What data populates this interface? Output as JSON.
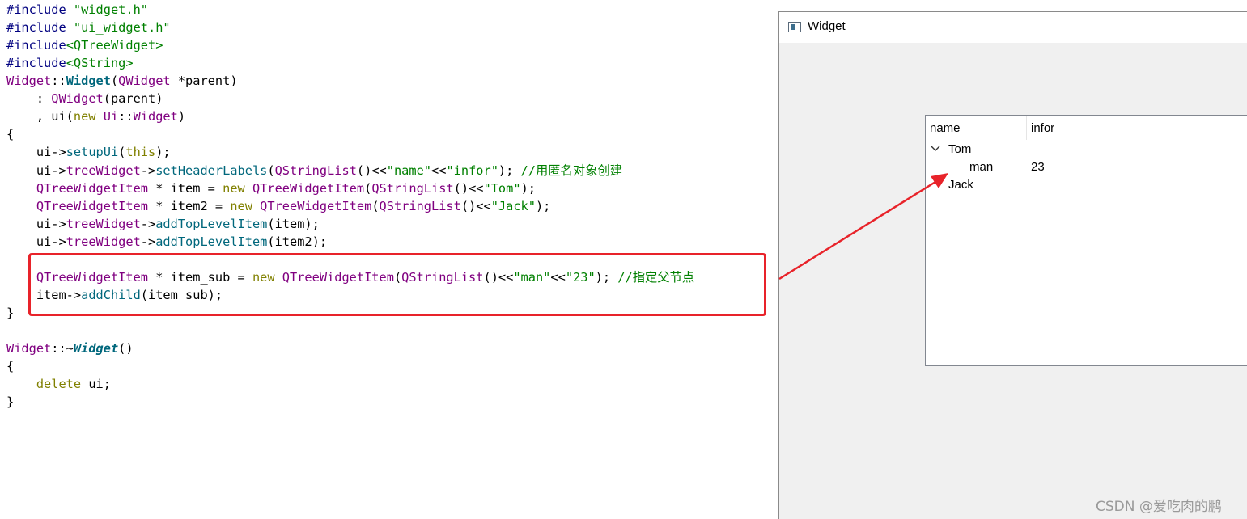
{
  "code": {
    "lines": [
      [
        [
          "#include ",
          "pre"
        ],
        [
          "\"widget.h\"",
          "str"
        ]
      ],
      [
        [
          "#include ",
          "pre"
        ],
        [
          "\"ui_widget.h\"",
          "str"
        ]
      ],
      [
        [
          "#include",
          "pre"
        ],
        [
          "<QTreeWidget>",
          "str"
        ]
      ],
      [
        [
          "#include",
          "pre"
        ],
        [
          "<QString>",
          "str"
        ]
      ],
      [
        [
          "Widget",
          "type"
        ],
        [
          "::",
          "plain"
        ],
        [
          "Widget",
          "funcbold"
        ],
        [
          "(",
          "plain"
        ],
        [
          "QWidget",
          "type"
        ],
        [
          " *parent)",
          "plain"
        ]
      ],
      [
        [
          "    : ",
          "plain"
        ],
        [
          "QWidget",
          "type"
        ],
        [
          "(parent)",
          "plain"
        ]
      ],
      [
        [
          "    , ui(",
          "plain"
        ],
        [
          "new",
          "kw"
        ],
        [
          " ",
          "plain"
        ],
        [
          "Ui",
          "type"
        ],
        [
          "::",
          "plain"
        ],
        [
          "Widget",
          "type"
        ],
        [
          ")",
          "plain"
        ]
      ],
      [
        [
          "{",
          "plain"
        ]
      ],
      [
        [
          "    ui->",
          "plain"
        ],
        [
          "setupUi",
          "func"
        ],
        [
          "(",
          "plain"
        ],
        [
          "this",
          "kw"
        ],
        [
          ");",
          "plain"
        ]
      ],
      [
        [
          "    ui->",
          "plain"
        ],
        [
          "treeWidget",
          "type"
        ],
        [
          "->",
          "plain"
        ],
        [
          "setHeaderLabels",
          "func"
        ],
        [
          "(",
          "plain"
        ],
        [
          "QStringList",
          "type"
        ],
        [
          "()<<",
          "plain"
        ],
        [
          "\"name\"",
          "str"
        ],
        [
          "<<",
          "plain"
        ],
        [
          "\"infor\"",
          "str"
        ],
        [
          "); ",
          "plain"
        ],
        [
          "//用匿名对象创建",
          "comment"
        ]
      ],
      [
        [
          "    ",
          "plain"
        ],
        [
          "QTreeWidgetItem",
          "type"
        ],
        [
          " * item = ",
          "plain"
        ],
        [
          "new",
          "kw"
        ],
        [
          " ",
          "plain"
        ],
        [
          "QTreeWidgetItem",
          "type"
        ],
        [
          "(",
          "plain"
        ],
        [
          "QStringList",
          "type"
        ],
        [
          "()<<",
          "plain"
        ],
        [
          "\"Tom\"",
          "str"
        ],
        [
          ");",
          "plain"
        ]
      ],
      [
        [
          "    ",
          "plain"
        ],
        [
          "QTreeWidgetItem",
          "type"
        ],
        [
          " * item2 = ",
          "plain"
        ],
        [
          "new",
          "kw"
        ],
        [
          " ",
          "plain"
        ],
        [
          "QTreeWidgetItem",
          "type"
        ],
        [
          "(",
          "plain"
        ],
        [
          "QStringList",
          "type"
        ],
        [
          "()<<",
          "plain"
        ],
        [
          "\"Jack\"",
          "str"
        ],
        [
          ");",
          "plain"
        ]
      ],
      [
        [
          "    ui->",
          "plain"
        ],
        [
          "treeWidget",
          "type"
        ],
        [
          "->",
          "plain"
        ],
        [
          "addTopLevelItem",
          "func"
        ],
        [
          "(item);",
          "plain"
        ]
      ],
      [
        [
          "    ui->",
          "plain"
        ],
        [
          "treeWidget",
          "type"
        ],
        [
          "->",
          "plain"
        ],
        [
          "addTopLevelItem",
          "func"
        ],
        [
          "(item2);",
          "plain"
        ]
      ],
      [],
      [
        [
          "    ",
          "plain"
        ],
        [
          "QTreeWidgetItem",
          "type"
        ],
        [
          " * item_sub = ",
          "plain"
        ],
        [
          "new",
          "kw"
        ],
        [
          " ",
          "plain"
        ],
        [
          "QTreeWidgetItem",
          "type"
        ],
        [
          "(",
          "plain"
        ],
        [
          "QStringList",
          "type"
        ],
        [
          "()<<",
          "plain"
        ],
        [
          "\"man\"",
          "str"
        ],
        [
          "<<",
          "plain"
        ],
        [
          "\"23\"",
          "str"
        ],
        [
          "); ",
          "plain"
        ],
        [
          "//指定父节点",
          "comment"
        ]
      ],
      [
        [
          "    item->",
          "plain"
        ],
        [
          "addChild",
          "func"
        ],
        [
          "(item_sub);",
          "plain"
        ]
      ],
      [
        [
          "}",
          "plain"
        ]
      ],
      [],
      [
        [
          "Widget",
          "type"
        ],
        [
          "::~",
          "plain"
        ],
        [
          "Widget",
          "funcbi"
        ],
        [
          "()",
          "plain"
        ]
      ],
      [
        [
          "{",
          "plain"
        ]
      ],
      [
        [
          "    ",
          "plain"
        ],
        [
          "delete",
          "kw"
        ],
        [
          " ui;",
          "plain"
        ]
      ],
      [
        [
          "}",
          "plain"
        ]
      ]
    ]
  },
  "window": {
    "title": "Widget",
    "icon": "qt-window-icon"
  },
  "tree": {
    "headers": [
      "name",
      "infor"
    ],
    "items": [
      {
        "name": "Tom",
        "infor": "",
        "expanded": true,
        "children": [
          {
            "name": "man",
            "infor": "23"
          }
        ]
      },
      {
        "name": "Jack",
        "infor": ""
      }
    ]
  },
  "annotations": {
    "highlight_color": "#e8232a",
    "arrow_color": "#e8232a"
  },
  "watermark": "CSDN @爱吃肉的鹏"
}
